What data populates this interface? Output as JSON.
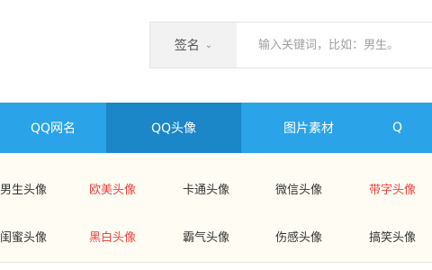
{
  "search": {
    "select_label": "签名",
    "placeholder": "输入关键词，比如：男生。"
  },
  "nav": {
    "items": [
      {
        "label": "QQ网名"
      },
      {
        "label": "QQ头像"
      },
      {
        "label": "图片素材"
      },
      {
        "label": "Q"
      }
    ]
  },
  "tags": {
    "row1": [
      "男生头像",
      "欧美头像",
      "卡通头像",
      "微信头像",
      "带字头像"
    ],
    "row2": [
      "闺蜜头像",
      "黑白头像",
      "霸气头像",
      "伤感头像",
      "搞笑头像"
    ]
  },
  "colors": {
    "nav_bg": "#2aa3e8",
    "nav_active": "#1b86c8",
    "tag_hot": "#e8423f",
    "tag_panel_bg": "#fffdf3"
  }
}
